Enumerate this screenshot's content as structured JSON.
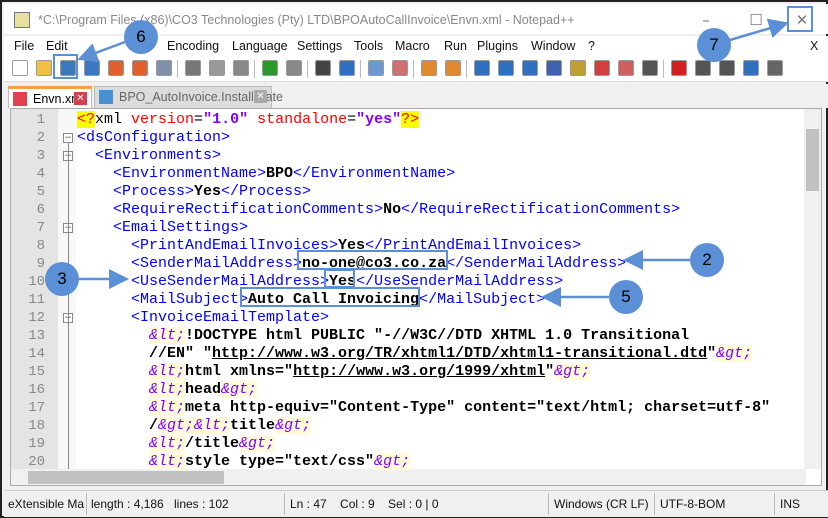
{
  "window": {
    "title": "*C:\\Program Files (x86)\\CO3 Technologies (Pty) LTD\\BPOAutoCallInvoice\\Envn.xml - Notepad++",
    "minimize": "–",
    "maximize": "☐",
    "close": "✕"
  },
  "menu": [
    {
      "label": "File"
    },
    {
      "label": "Edit"
    },
    {
      "label": "Encoding"
    },
    {
      "label": "Language"
    },
    {
      "label": "Settings"
    },
    {
      "label": "Tools"
    },
    {
      "label": "Macro"
    },
    {
      "label": "Run"
    },
    {
      "label": "Plugins"
    },
    {
      "label": "Window"
    },
    {
      "label": "?"
    }
  ],
  "menu_close": "X",
  "toolbar": [
    {
      "icon": "new-file-icon",
      "color": "#ffffff"
    },
    {
      "icon": "open-file-icon",
      "color": "#f0c040"
    },
    {
      "icon": "save-icon",
      "color": "#3a78c0"
    },
    {
      "icon": "save-all-icon",
      "color": "#3a78c0"
    },
    {
      "icon": "close-icon",
      "color": "#e06030"
    },
    {
      "icon": "close-all-icon",
      "color": "#e06030"
    },
    {
      "icon": "print-icon",
      "color": "#8090a8"
    },
    {
      "icon": "cut-icon",
      "color": "#777777"
    },
    {
      "icon": "copy-icon",
      "color": "#999999"
    },
    {
      "icon": "paste-icon",
      "color": "#888888"
    },
    {
      "icon": "undo-icon",
      "color": "#2a9a2a"
    },
    {
      "icon": "redo-icon",
      "color": "#888888"
    },
    {
      "icon": "find-icon",
      "color": "#444444"
    },
    {
      "icon": "replace-icon",
      "color": "#3070c0"
    },
    {
      "icon": "zoom-in-icon",
      "color": "#6a9ad0"
    },
    {
      "icon": "zoom-out-icon",
      "color": "#d07070"
    },
    {
      "icon": "sync-vertical-icon",
      "color": "#e08a30"
    },
    {
      "icon": "sync-horizontal-icon",
      "color": "#e08a30"
    },
    {
      "icon": "word-wrap-icon",
      "color": "#3070c0"
    },
    {
      "icon": "show-all-chars-icon",
      "color": "#3070c0"
    },
    {
      "icon": "indent-guide-icon",
      "color": "#3070c0"
    },
    {
      "icon": "udl-icon",
      "color": "#4060b0"
    },
    {
      "icon": "doc-map-icon",
      "color": "#c0a030"
    },
    {
      "icon": "function-list-icon",
      "color": "#d04040"
    },
    {
      "icon": "folder-workspace-icon",
      "color": "#d06060"
    },
    {
      "icon": "monitor-icon",
      "color": "#555555"
    },
    {
      "icon": "record-macro-icon",
      "color": "#d02020"
    },
    {
      "icon": "stop-macro-icon",
      "color": "#555555"
    },
    {
      "icon": "play-macro-icon",
      "color": "#555555"
    },
    {
      "icon": "run-macro-multiple-icon",
      "color": "#3070c0"
    },
    {
      "icon": "save-macro-icon",
      "color": "#666666"
    }
  ],
  "tabs": [
    {
      "label": "Envn.xml",
      "active": true,
      "color": "#e04050"
    },
    {
      "label": "BPO_AutoInvoice.InstallState",
      "active": false,
      "color": "#4a90d0"
    }
  ],
  "editor": {
    "line_numbers": [
      "1",
      "2",
      "3",
      "4",
      "5",
      "6",
      "7",
      "8",
      "9",
      "10",
      "11",
      "12",
      "13",
      "14",
      "15",
      "16",
      "17",
      "18",
      "19",
      "20"
    ],
    "lines": [
      [
        [
          "p",
          "<?"
        ],
        [
          "n",
          "xml"
        ],
        [
          "a",
          " version"
        ],
        [
          "n",
          "="
        ],
        [
          "v",
          "\"1.0\""
        ],
        [
          "a",
          " standalone"
        ],
        [
          "n",
          "="
        ],
        [
          "v",
          "\"yes\""
        ],
        [
          "p",
          "?>"
        ]
      ],
      [
        [
          "t",
          "<dsConfiguration>"
        ]
      ],
      [
        [
          "t",
          "  <Environments>"
        ]
      ],
      [
        [
          "t",
          "    <EnvironmentName>"
        ],
        [
          "x",
          "BPO"
        ],
        [
          "t",
          "</EnvironmentName>"
        ]
      ],
      [
        [
          "t",
          "    <Process>"
        ],
        [
          "x",
          "Yes"
        ],
        [
          "t",
          "</Process>"
        ]
      ],
      [
        [
          "t",
          "    <RequireRectificationComments>"
        ],
        [
          "x",
          "No"
        ],
        [
          "t",
          "</RequireRectificationComments>"
        ]
      ],
      [
        [
          "t",
          "    <EmailSettings>"
        ]
      ],
      [
        [
          "t",
          "      <PrintAndEmailInvoices>"
        ],
        [
          "x",
          "Yes"
        ],
        [
          "t",
          "</PrintAndEmailInvoices>"
        ]
      ],
      [
        [
          "t",
          "      <SenderMailAddress>"
        ],
        [
          "x",
          "no-one@co3.co.za"
        ],
        [
          "t",
          "</SenderMailAddress>"
        ]
      ],
      [
        [
          "t",
          "      <UseSenderMailAddress>"
        ],
        [
          "x",
          "Yes"
        ],
        [
          "t",
          "</UseSenderMailAddress>"
        ]
      ],
      [
        [
          "t",
          "      <MailSubject>"
        ],
        [
          "x",
          "Auto Call Invoicing"
        ],
        [
          "t",
          "</MailSubject>"
        ]
      ],
      [
        [
          "t",
          "      <InvoiceEmailTemplate>"
        ]
      ],
      [
        [
          "x",
          "        "
        ],
        [
          "e",
          "&lt;"
        ],
        [
          "x",
          "!DOCTYPE html PUBLIC \"-//W3C//DTD XHTML 1.0 Transitional"
        ]
      ],
      [
        [
          "x",
          "        //EN\" \""
        ],
        [
          "u",
          "http://www.w3.org/TR/xhtml1/DTD/xhtml1-transitional.dtd"
        ],
        [
          "x",
          "\""
        ],
        [
          "e",
          "&gt;"
        ]
      ],
      [
        [
          "x",
          "        "
        ],
        [
          "e",
          "&lt;"
        ],
        [
          "x",
          "html xmlns=\""
        ],
        [
          "u",
          "http://www.w3.org/1999/xhtml"
        ],
        [
          "x",
          "\""
        ],
        [
          "e",
          "&gt;"
        ]
      ],
      [
        [
          "x",
          "        "
        ],
        [
          "e",
          "&lt;"
        ],
        [
          "x",
          "head"
        ],
        [
          "e",
          "&gt;"
        ]
      ],
      [
        [
          "x",
          "        "
        ],
        [
          "e",
          "&lt;"
        ],
        [
          "x",
          "meta http-equiv=\"Content-Type\" content=\"text/html; charset=utf-8\""
        ]
      ],
      [
        [
          "x",
          "        /"
        ],
        [
          "e",
          "&gt;"
        ],
        [
          "e",
          "&lt;"
        ],
        [
          "x",
          "title"
        ],
        [
          "e",
          "&gt;"
        ]
      ],
      [
        [
          "x",
          "        "
        ],
        [
          "e",
          "&lt;"
        ],
        [
          "x",
          "/title"
        ],
        [
          "e",
          "&gt;"
        ]
      ],
      [
        [
          "x",
          "        "
        ],
        [
          "e",
          "&lt;"
        ],
        [
          "x",
          "style type=\"text/css\""
        ],
        [
          "e",
          "&gt;"
        ]
      ]
    ],
    "fold_markers": [
      "2",
      "3",
      "7",
      "12"
    ]
  },
  "status": {
    "lang": "eXtensible Ma",
    "length": "length : 4,186",
    "lines": "lines : 102",
    "position": "Ln : 47    Col : 9    Sel : 0 | 0",
    "eol": "Windows (CR LF)",
    "encoding": "UTF-8-BOM",
    "mode": "INS"
  },
  "annotations": {
    "callouts": [
      "6",
      "7",
      "2",
      "3",
      "5"
    ],
    "color": "#5b8fd6"
  }
}
